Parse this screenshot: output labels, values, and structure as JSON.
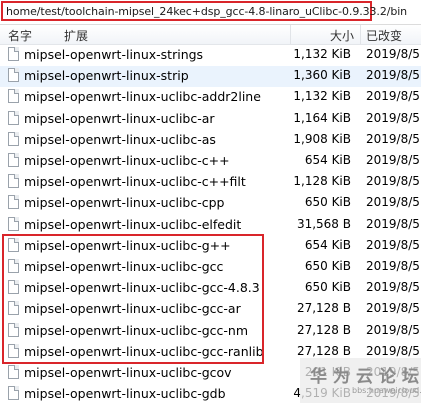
{
  "path": "home/test/toolchain-mipsel_24kec+dsp_gcc-4.8-linaro_uClibc-0.9.33.2/bin",
  "columns": {
    "name": "名字",
    "ext": "扩展",
    "size": "大小",
    "modified": "已改变"
  },
  "files": [
    {
      "name": "mipsel-openwrt-linux-strings",
      "size": "1,132 KiB",
      "date": "2019/8/5"
    },
    {
      "name": "mipsel-openwrt-linux-strip",
      "size": "1,360 KiB",
      "date": "2019/8/5",
      "selected": true
    },
    {
      "name": "mipsel-openwrt-linux-uclibc-addr2line",
      "size": "1,132 KiB",
      "date": "2019/8/5"
    },
    {
      "name": "mipsel-openwrt-linux-uclibc-ar",
      "size": "1,164 KiB",
      "date": "2019/8/5"
    },
    {
      "name": "mipsel-openwrt-linux-uclibc-as",
      "size": "1,908 KiB",
      "date": "2019/8/5"
    },
    {
      "name": "mipsel-openwrt-linux-uclibc-c++",
      "size": "654 KiB",
      "date": "2019/8/5"
    },
    {
      "name": "mipsel-openwrt-linux-uclibc-c++filt",
      "size": "1,128 KiB",
      "date": "2019/8/5"
    },
    {
      "name": "mipsel-openwrt-linux-uclibc-cpp",
      "size": "650 KiB",
      "date": "2019/8/5"
    },
    {
      "name": "mipsel-openwrt-linux-uclibc-elfedit",
      "size": "31,568 B",
      "date": "2019/8/5"
    },
    {
      "name": "mipsel-openwrt-linux-uclibc-g++",
      "size": "654 KiB",
      "date": "2019/8/5"
    },
    {
      "name": "mipsel-openwrt-linux-uclibc-gcc",
      "size": "650 KiB",
      "date": "2019/8/5"
    },
    {
      "name": "mipsel-openwrt-linux-uclibc-gcc-4.8.3",
      "size": "650 KiB",
      "date": "2019/8/5"
    },
    {
      "name": "mipsel-openwrt-linux-uclibc-gcc-ar",
      "size": "27,128 B",
      "date": "2019/8/5"
    },
    {
      "name": "mipsel-openwrt-linux-uclibc-gcc-nm",
      "size": "27,128 B",
      "date": "2019/8/5"
    },
    {
      "name": "mipsel-openwrt-linux-uclibc-gcc-ranlib",
      "size": "27,128 B",
      "date": "2019/8/5"
    },
    {
      "name": "mipsel-openwrt-linux-uclibc-gcov",
      "size": "291 KiB",
      "date": "2019/8/5"
    },
    {
      "name": "mipsel-openwrt-linux-uclibc-gdb",
      "size": "4,519 KiB",
      "date": "2019/8/5"
    }
  ],
  "watermark": {
    "main": "华为云论坛",
    "sub": "bbs.huaweicloud.com"
  },
  "colors": {
    "highlight_border": "#d9252a",
    "selected_row": "#eaf3fd"
  }
}
